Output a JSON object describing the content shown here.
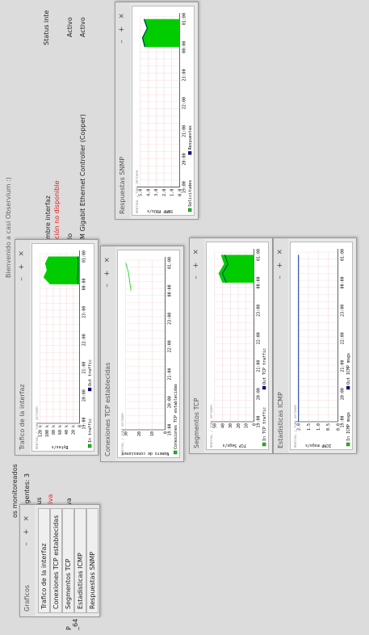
{
  "welcome": "Bienvenido a casi Observium :)",
  "bg": {
    "monitored": "os monitoreados",
    "agents": "de agentes: 3",
    "status_header": "Status",
    "inactive": "nactiva",
    "active": "Activa",
    "left_frag1": "P",
    "left_frag2": "_64",
    "if_name_header": "mbre interfaz",
    "unavailable": "ción no disponible",
    "lo": "lo",
    "gigabit": "M Gigabit Ethernet Controller (Copper)",
    "status_header2": "Status inte",
    "activo1": "Activo",
    "activo2": "Activo"
  },
  "menu": {
    "title": "Graficos",
    "items": [
      "Trafico de la interfaz",
      "Conexiones TCP establecidas",
      "Segmentos TCP",
      "Estadisticas ICMP",
      "Respuestas SNMP"
    ]
  },
  "windows": {
    "trafico": {
      "title": "Trafico de la interfaz",
      "ylabel": "Bytes/s",
      "yticks": [
        "120 k",
        "100 k",
        "80 k",
        "60 k",
        "40 k",
        "20 k",
        "0"
      ],
      "legend": [
        "In traffic",
        "Out traffic"
      ]
    },
    "conexiones": {
      "title": "Conexiones TCP establecidas",
      "ylabel": "Numero de conexiones",
      "yticks": [
        "30",
        "20",
        "10",
        "0"
      ],
      "legend": [
        "Conexiones TCP establecidas"
      ]
    },
    "segmentos": {
      "title": "Segmentos TCP",
      "ylabel": "TCP Segs/s",
      "yticks": [
        "50",
        "40",
        "30",
        "20",
        "10",
        "0"
      ],
      "legend": [
        "In TCP traffic",
        "Out TCP traffic"
      ]
    },
    "icmp": {
      "title": "Estadisticas ICMP",
      "ylabel": "ICMP msgs/s",
      "yticks": [
        "2.0",
        "1.5",
        "1.0",
        "0.5",
        "0.0"
      ],
      "legend": [
        "In ICMP msgs",
        "Out ICMP msgs"
      ]
    },
    "snmp": {
      "title": "Respuestas SNMP",
      "ylabel": "SNMP PDUs/s",
      "yticks": [
        "5.0",
        "4.0",
        "3.0",
        "2.0",
        "1.0",
        "0.0"
      ],
      "legend": [
        "Solicitudes",
        "Respuestas"
      ]
    }
  },
  "xticks": [
    "19:00",
    "20:00",
    "21:00",
    "22:00",
    "23:00",
    "00:00",
    "01:00"
  ],
  "rrd": "RRDTOOL / TOBI OETIKER",
  "colors": {
    "green": "#00cc00",
    "blue": "#0000aa",
    "grid": "#f0c8c8",
    "red": "#cc0000"
  },
  "chart_data": [
    {
      "type": "area",
      "title": "Trafico de la interfaz",
      "ylabel": "Bytes/s",
      "x": [
        "19:00",
        "20:00",
        "21:00",
        "22:00",
        "23:00",
        "00:00",
        "01:00"
      ],
      "ylim": [
        0,
        120000
      ],
      "series": [
        {
          "name": "In traffic",
          "x": [
            "00:00",
            "00:15",
            "00:30",
            "00:45",
            "01:00"
          ],
          "values": [
            90000,
            110000,
            100000,
            105000,
            95000
          ]
        },
        {
          "name": "Out traffic",
          "x": [
            "00:00",
            "00:15",
            "00:30",
            "00:45",
            "01:00"
          ],
          "values": [
            5000,
            6000,
            4000,
            5000,
            5000
          ]
        }
      ]
    },
    {
      "type": "line",
      "title": "Conexiones TCP establecidas",
      "ylabel": "Numero de conexiones",
      "x": [
        "19:00",
        "20:00",
        "21:00",
        "22:00",
        "23:00",
        "00:00",
        "01:00"
      ],
      "ylim": [
        0,
        30
      ],
      "series": [
        {
          "name": "Conexiones TCP establecidas",
          "x": [
            "00:00",
            "00:20",
            "00:40",
            "01:00"
          ],
          "values": [
            26,
            27,
            28,
            30
          ]
        }
      ]
    },
    {
      "type": "area",
      "title": "Segmentos TCP",
      "ylabel": "TCP Segs/s",
      "x": [
        "19:00",
        "20:00",
        "21:00",
        "22:00",
        "23:00",
        "00:00",
        "01:00"
      ],
      "ylim": [
        0,
        50
      ],
      "series": [
        {
          "name": "In TCP traffic",
          "x": [
            "00:00",
            "00:20",
            "00:40",
            "01:00"
          ],
          "values": [
            40,
            45,
            38,
            42
          ]
        },
        {
          "name": "Out TCP traffic",
          "x": [
            "00:00",
            "00:20",
            "00:40",
            "01:00"
          ],
          "values": [
            35,
            40,
            33,
            37
          ]
        }
      ]
    },
    {
      "type": "line",
      "title": "Estadisticas ICMP",
      "ylabel": "ICMP msgs/s",
      "x": [
        "19:00",
        "20:00",
        "21:00",
        "22:00",
        "23:00",
        "00:00",
        "01:00"
      ],
      "ylim": [
        0,
        2.0
      ],
      "series": [
        {
          "name": "In ICMP msgs",
          "x": [
            "19:00",
            "00:00",
            "01:00"
          ],
          "values": [
            2.0,
            2.0,
            2.0
          ]
        },
        {
          "name": "Out ICMP msgs",
          "x": [
            "19:00",
            "00:00",
            "01:00"
          ],
          "values": [
            2.0,
            2.0,
            2.0
          ]
        }
      ]
    },
    {
      "type": "area",
      "title": "Respuestas SNMP",
      "ylabel": "SNMP PDUs/s",
      "x": [
        "19:00",
        "20:00",
        "21:00",
        "22:00",
        "23:00",
        "00:00",
        "01:00"
      ],
      "ylim": [
        0,
        5
      ],
      "series": [
        {
          "name": "Solicitudes",
          "x": [
            "00:00",
            "00:20",
            "00:40",
            "01:00"
          ],
          "values": [
            4.5,
            4.8,
            4.2,
            4.6
          ]
        },
        {
          "name": "Respuestas",
          "x": [
            "00:00",
            "00:20",
            "00:40",
            "01:00"
          ],
          "values": [
            4.4,
            4.7,
            4.1,
            4.5
          ]
        }
      ]
    }
  ]
}
